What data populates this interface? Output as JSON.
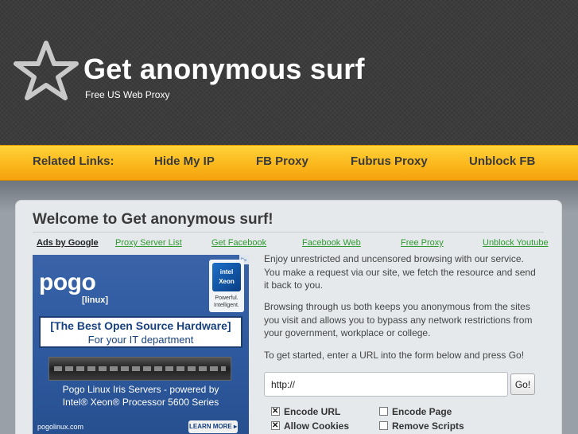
{
  "header": {
    "title": "Get anonymous surf",
    "subtitle": "Free US Web Proxy",
    "logo_icon": "star-icon"
  },
  "nav": {
    "related_label": "Related Links:",
    "items": [
      "Hide My IP",
      "FB Proxy",
      "Fubrus Proxy",
      "Unblock FB"
    ]
  },
  "main": {
    "heading": "Welcome to Get anonymous surf!",
    "ads_label": "Ads by Google",
    "ad_links": [
      "Proxy Server List",
      "Get Facebook",
      "Facebook Web",
      "Free Proxy",
      "Unblock Youtube"
    ],
    "paragraphs": [
      "Enjoy unrestricted and uncensored browsing with our service. You make a request via our site, we fetch the resource and send it back to you.",
      "Browsing through us both keeps you anonymous from the sites you visit and allows you to bypass any network restrictions from your government, workplace or college.",
      "To get started, enter a URL into the form below and press Go!"
    ],
    "url_value": "http://",
    "go_label": "Go!",
    "options": {
      "encode_url": "Encode URL",
      "encode_page": "Encode Page",
      "allow_cookies": "Allow Cookies",
      "remove_scripts": "Remove Scripts"
    }
  },
  "ad": {
    "brand": "pogo",
    "brand_sub": "[linux]",
    "adchoices": "▷",
    "intel_badge": "intel Xeon",
    "intel_text": "Powerful. Intelligent.",
    "headline": "[The Best Open Source Hardware]",
    "subline": "For your IT department",
    "copy_line1": "Pogo Linux Iris Servers - powered by",
    "copy_line2": "Intel® Xeon® Processor 5600 Series",
    "url": "pogolinux.com",
    "cta": "LEARN MORE ▸"
  },
  "colors": {
    "header_bg": "#3c3c3c",
    "nav_gold": "#fbb81c",
    "panel_bg": "#e6e9ec",
    "link_green": "#2f9a2f",
    "ad_blue": "#2f5aa0"
  }
}
